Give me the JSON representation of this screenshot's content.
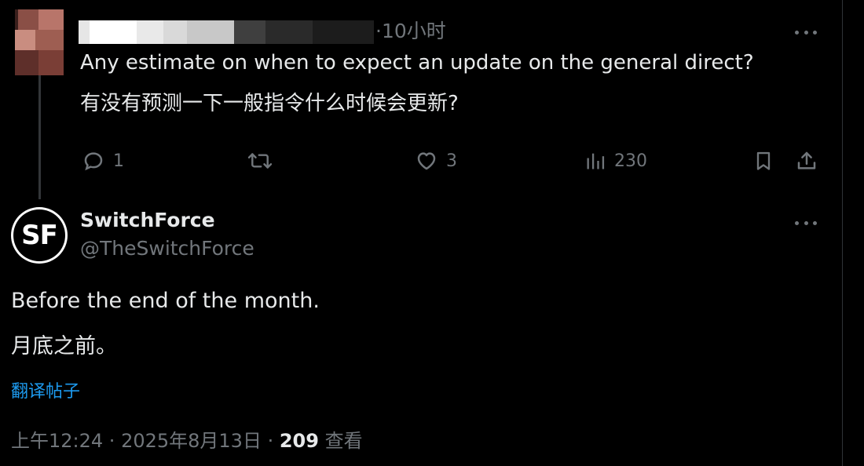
{
  "colors": {
    "background": "#000000",
    "text_primary": "#e7e9ea",
    "text_secondary": "#71767b",
    "link": "#1d9bf0",
    "divider": "#2f3336"
  },
  "reply_tweet": {
    "time": "10小时",
    "more_icon": "more-horizontal-icon",
    "text_en": "Any estimate on when to expect an update on the general direct?",
    "text_zh": "有没有预测一下一般指令什么时候会更新?",
    "actions": {
      "reply": {
        "icon": "reply-icon",
        "count": "1"
      },
      "retweet": {
        "icon": "retweet-icon",
        "count": ""
      },
      "like": {
        "icon": "heart-icon",
        "count": "3"
      },
      "views": {
        "icon": "views-chart-icon",
        "count": "230"
      },
      "bookmark": {
        "icon": "bookmark-icon"
      },
      "share": {
        "icon": "share-icon"
      }
    }
  },
  "main_tweet": {
    "avatar_text": "SF",
    "display_name": "SwitchForce",
    "handle": "@TheSwitchForce",
    "more_icon": "more-horizontal-icon",
    "text_en": "Before the end of the month.",
    "text_zh": "月底之前。",
    "translate_label": "翻译帖子",
    "meta_time": "上午12:24",
    "meta_sep1": " · ",
    "meta_date": "2025年8月13日",
    "meta_sep2": " · ",
    "views_count": "209",
    "views_label": " 查看"
  }
}
